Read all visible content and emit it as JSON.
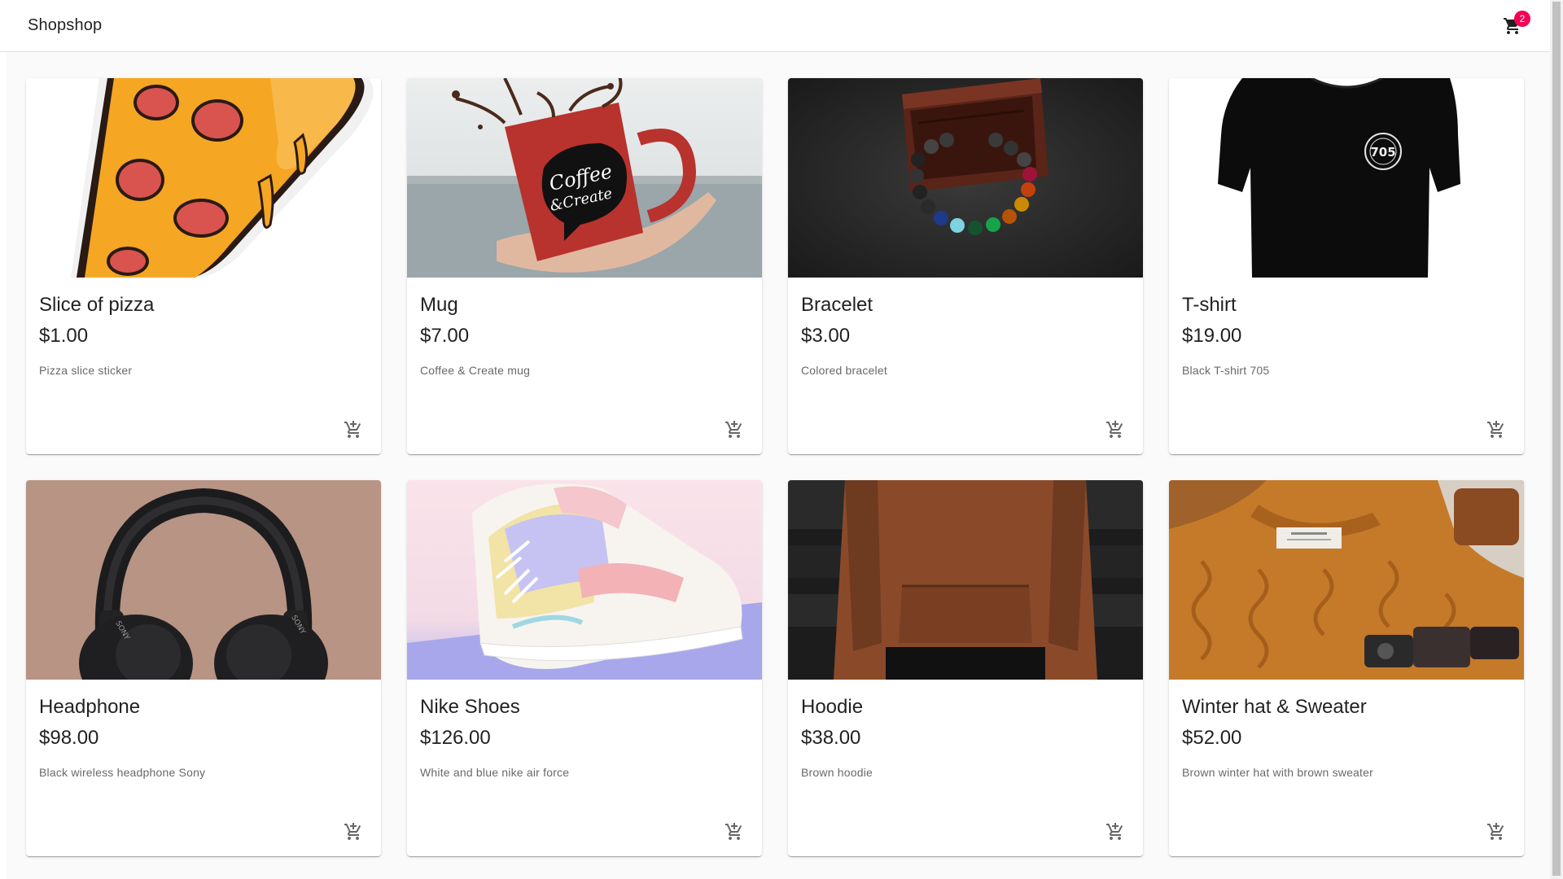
{
  "app": {
    "title": "Shopshop",
    "cart_count": "2"
  },
  "products": [
    {
      "title": "Slice of pizza",
      "price": "$1.00",
      "description": "Pizza slice sticker"
    },
    {
      "title": "Mug",
      "price": "$7.00",
      "description": "Coffee & Create mug"
    },
    {
      "title": "Bracelet",
      "price": "$3.00",
      "description": "Colored bracelet"
    },
    {
      "title": "T-shirt",
      "price": "$19.00",
      "description": "Black T-shirt 705"
    },
    {
      "title": "Headphone",
      "price": "$98.00",
      "description": "Black wireless headphone Sony"
    },
    {
      "title": "Nike Shoes",
      "price": "$126.00",
      "description": "White and blue nike air force"
    },
    {
      "title": "Hoodie",
      "price": "$38.00",
      "description": "Brown hoodie"
    },
    {
      "title": "Winter hat & Sweater",
      "price": "$52.00",
      "description": "Brown winter hat with brown sweater"
    }
  ],
  "images": {
    "mug_text": "Coffee & Create",
    "tshirt_logo": "705",
    "headphone_brand": "SONY"
  },
  "icons": {
    "cart": "shopping-cart-icon",
    "add_to_cart": "add-shopping-cart-icon"
  },
  "colors": {
    "badge": "#f50057",
    "appbar": "#ffffff",
    "background": "#fafafa"
  }
}
